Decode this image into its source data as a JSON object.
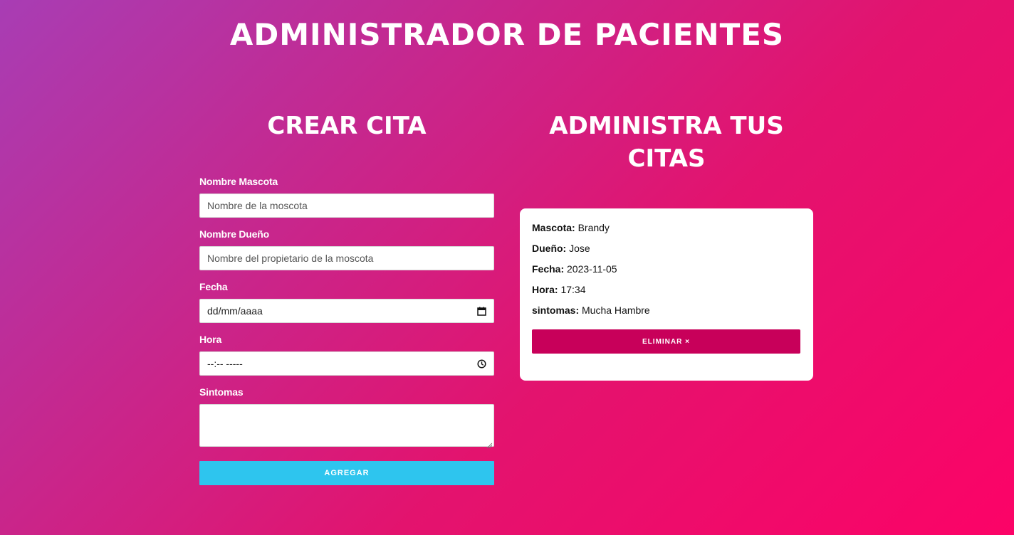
{
  "header": {
    "title": "ADMINISTRADOR DE PACIENTES"
  },
  "form": {
    "title": "CREAR CITA",
    "pet_label": "Nombre Mascota",
    "pet_placeholder": "Nombre de la moscota",
    "owner_label": "Nombre Dueño",
    "owner_placeholder": "Nombre del propietario de la moscota",
    "date_label": "Fecha",
    "date_value": "dd/mm/aaaa",
    "time_label": "Hora",
    "time_value": "--:-- -----",
    "symptoms_label": "Sintomas",
    "submit_label": "AGREGAR"
  },
  "appointments": {
    "title": "ADMINISTRA TUS CITAS",
    "items": [
      {
        "pet_label": "Mascota:",
        "pet": "Brandy",
        "owner_label": "Dueño:",
        "owner": "Jose",
        "date_label": "Fecha:",
        "date": "2023-11-05",
        "time_label": "Hora:",
        "time": "17:34",
        "symptoms_label": "sintomas:",
        "symptoms": "Mucha Hambre",
        "delete_label": "ELIMINAR ×"
      }
    ]
  },
  "icons": {
    "date": "calendar-icon",
    "time": "clock-icon"
  },
  "colors": {
    "add_button": "#2ec5ee",
    "delete_button": "#c8005a",
    "gradient_start": "#a83db4",
    "gradient_end": "#fc0367"
  }
}
